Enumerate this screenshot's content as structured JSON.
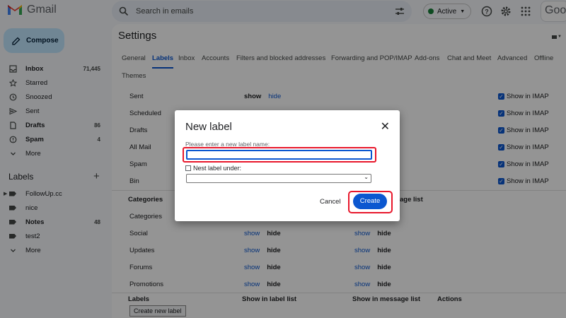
{
  "app": {
    "name": "Gmail",
    "partial_brand": "Goog"
  },
  "search": {
    "placeholder": "Search in emails"
  },
  "status": {
    "label": "Active",
    "color": "#188038"
  },
  "compose_label": "Compose",
  "nav": [
    {
      "label": "Inbox",
      "count": "71,445",
      "icon": "inbox-icon",
      "bold": true
    },
    {
      "label": "Starred",
      "count": "",
      "icon": "star-icon",
      "bold": false
    },
    {
      "label": "Snoozed",
      "count": "",
      "icon": "clock-icon",
      "bold": false
    },
    {
      "label": "Sent",
      "count": "",
      "icon": "send-icon",
      "bold": false
    },
    {
      "label": "Drafts",
      "count": "86",
      "icon": "draft-icon",
      "bold": true
    },
    {
      "label": "Spam",
      "count": "4",
      "icon": "spam-icon",
      "bold": true
    },
    {
      "label": "More",
      "count": "",
      "icon": "chevron-down-icon",
      "bold": false
    }
  ],
  "labels_section": {
    "title": "Labels",
    "items": [
      {
        "label": "FollowUp.cc",
        "count": "",
        "bold": false
      },
      {
        "label": "nice",
        "count": "",
        "bold": false
      },
      {
        "label": "Notes",
        "count": "48",
        "bold": true
      },
      {
        "label": "test2",
        "count": "",
        "bold": false
      },
      {
        "label": "More",
        "count": "",
        "bold": false
      }
    ]
  },
  "settings": {
    "title": "Settings",
    "tabs": [
      "General",
      "Labels",
      "Inbox",
      "Accounts",
      "Filters and blocked addresses",
      "Forwarding and POP/IMAP",
      "Add-ons",
      "Chat and Meet",
      "Advanced",
      "Offline",
      "Themes"
    ],
    "active_tab": "Labels",
    "system_labels": [
      {
        "name": "Sent",
        "show": "show",
        "hide": "hide",
        "imap": "Show in IMAP"
      },
      {
        "name": "Scheduled",
        "imap": "Show in IMAP"
      },
      {
        "name": "Drafts",
        "imap": "Show in IMAP"
      },
      {
        "name": "All Mail",
        "imap": "Show in IMAP"
      },
      {
        "name": "Spam",
        "imap": "Show in IMAP"
      },
      {
        "name": "Bin",
        "imap": "Show in IMAP"
      }
    ],
    "categories_header": {
      "col1": "Categories",
      "col3_suffix": "age list"
    },
    "categories": [
      {
        "name": "Categories"
      },
      {
        "name": "Social",
        "show": "show",
        "hide": "hide",
        "show2": "show",
        "hide2": "hide"
      },
      {
        "name": "Updates",
        "show": "show",
        "hide": "hide",
        "show2": "show",
        "hide2": "hide"
      },
      {
        "name": "Forums",
        "show": "show",
        "hide": "hide",
        "show2": "show",
        "hide2": "hide"
      },
      {
        "name": "Promotions",
        "show": "show",
        "hide": "hide",
        "show2": "show",
        "hide2": "hide"
      }
    ],
    "labels_header": {
      "col1": "Labels",
      "col2": "Show in label list",
      "col3": "Show in message list",
      "col4": "Actions"
    },
    "create_new_label": "Create new label"
  },
  "dialog": {
    "title": "New label",
    "prompt": "Please enter a new label name:",
    "input_value": "",
    "nest_label": "Nest label under:",
    "cancel": "Cancel",
    "create": "Create",
    "highlight_color": "#e8172b"
  }
}
